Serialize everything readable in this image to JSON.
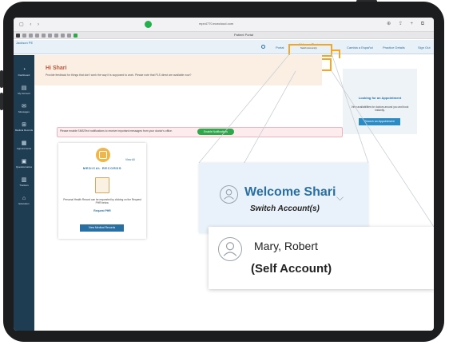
{
  "browser": {
    "url": "mpn4770.ecwcloud.com",
    "tab_title": "Patient Portal"
  },
  "header": {
    "brand": "Jackson PE",
    "items": [
      "Portal",
      "Cambia a Español",
      "Practice Details",
      "Sign Out"
    ],
    "welcome": "Welcome Shari",
    "switch_account": "Switch Account(s)"
  },
  "account_dropdown": {
    "name": "Mary, Robert",
    "self": "(Self Account)"
  },
  "sidebar": {
    "items": [
      "Dashboard",
      "My Account",
      "Messages",
      "Medical Records",
      "Appointments",
      "Questionnaires",
      "Trackers",
      "Education"
    ]
  },
  "main": {
    "greeting": "Hi Shari",
    "feedback": "Provide feedback for things that don't work the way it is supposed to work. Please note that PLS direct are available now?",
    "sms_text": "Please enable SMS/Text notifications to receive important messages from your doctor's office.",
    "sms_button": "Enable Notifications"
  },
  "appointment_panel": {
    "title": "Looking for an Appointment",
    "text": "View availabilities for doctors around you and book instantly.",
    "button": "Search an Appointment"
  },
  "medical_card": {
    "title": "MEDICAL RECORDS",
    "view_all": "View All",
    "text": "Personal Health Record can be requested by clicking on the Request PHR below.",
    "link": "Request PHR",
    "button": "View Medical Records"
  },
  "colors": {
    "accent": "#2a6fa1",
    "highlight": "#f5a623",
    "green": "#2ea84a",
    "sidebar": "#1f3d52"
  }
}
